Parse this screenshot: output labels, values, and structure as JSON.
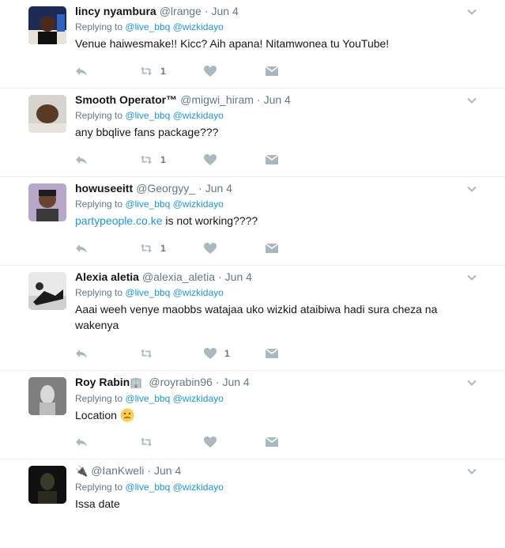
{
  "colors": {
    "link": "#1b95e0",
    "muted": "#657786",
    "text": "#14171a",
    "divider": "#e6ecf0",
    "icon": "#aab8c2"
  },
  "tweets": [
    {
      "fullname": "lincy nyambura",
      "username": "@lrange",
      "time": "Jun 4",
      "replying_label": "Replying to",
      "replying_to": [
        "@live_bbq",
        "@wizkidayo"
      ],
      "text": "Venue haiwesmake!! Kicc?  Aih apana! Nitamwonea tu YouTube!",
      "retweet_count": "1",
      "like_count": ""
    },
    {
      "fullname": "Smooth Operator™",
      "username": "@migwi_hiram",
      "time": "Jun 4",
      "replying_label": "Replying to",
      "replying_to": [
        "@live_bbq",
        "@wizkidayo"
      ],
      "text": "any bbqlive fans package???",
      "retweet_count": "1",
      "like_count": ""
    },
    {
      "fullname": "howuseeitt",
      "username": "@Georgyy_",
      "time": "Jun 4",
      "replying_label": "Replying to",
      "replying_to": [
        "@live_bbq",
        "@wizkidayo"
      ],
      "link_text": "partypeople.co.ke",
      "text": " is not working????",
      "retweet_count": "1",
      "like_count": ""
    },
    {
      "fullname": "Alexia aletia",
      "username": "@alexia_aletia",
      "time": "Jun 4",
      "replying_label": "Replying to",
      "replying_to": [
        "@live_bbq",
        "@wizkidayo"
      ],
      "text_line1": "Aaai weeh venye maobbs watajaa uko wizkid ataibiwa hadi sura cheza na",
      "text_line2": "wakenya",
      "retweet_count": "",
      "like_count": "1"
    },
    {
      "fullname": "Roy Rabin",
      "name_suffix_icon": "building-icon",
      "username": "@royrabin96",
      "time": "Jun 4",
      "replying_label": "Replying to",
      "replying_to": [
        "@live_bbq",
        "@wizkidayo"
      ],
      "text": "Location ",
      "emoji": "confused-face-emoji",
      "retweet_count": "",
      "like_count": ""
    },
    {
      "fullname": "",
      "name_prefix_icon": "plug-icon",
      "username": "@IanKweli",
      "time": "Jun 4",
      "replying_label": "Replying to",
      "replying_to": [
        "@live_bbq",
        "@wizkidayo"
      ],
      "text": "Issa date",
      "retweet_count": "",
      "like_count": ""
    }
  ]
}
